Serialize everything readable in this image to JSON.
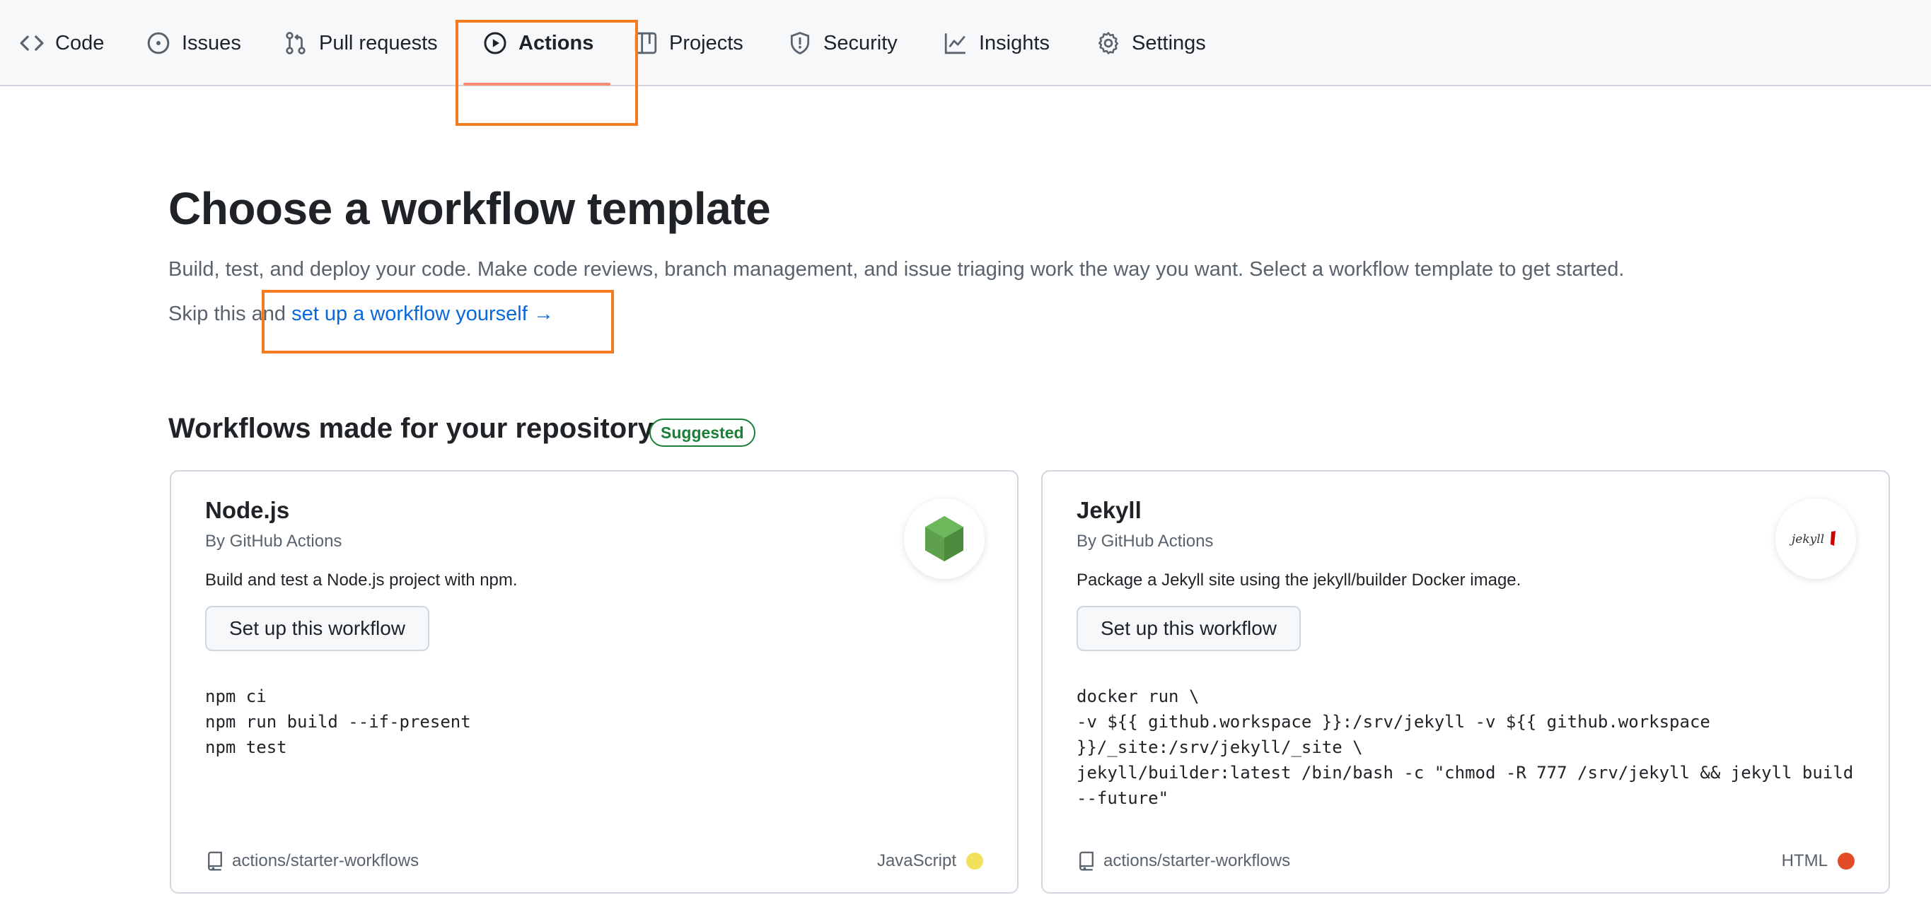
{
  "nav": {
    "tabs": [
      {
        "label": "Code",
        "icon": "code-icon"
      },
      {
        "label": "Issues",
        "icon": "issue-opened-icon"
      },
      {
        "label": "Pull requests",
        "icon": "git-pull-request-icon"
      },
      {
        "label": "Actions",
        "icon": "play-icon",
        "active": true
      },
      {
        "label": "Projects",
        "icon": "table-icon"
      },
      {
        "label": "Security",
        "icon": "shield-icon"
      },
      {
        "label": "Insights",
        "icon": "graph-icon"
      },
      {
        "label": "Settings",
        "icon": "gear-icon"
      }
    ]
  },
  "hero": {
    "title": "Choose a workflow template",
    "description": "Build, test, and deploy your code. Make code reviews, branch management, and issue triaging work the way you want. Select a workflow template to get started.",
    "skip_prefix": "Skip this and ",
    "skip_link": "set up a workflow yourself",
    "skip_arrow": "→"
  },
  "section": {
    "title": "Workflows made for your repository",
    "badge": "Suggested"
  },
  "cards": [
    {
      "title": "Node.js",
      "author": "By GitHub Actions",
      "description": "Build and test a Node.js project with npm.",
      "button": "Set up this workflow",
      "code": "npm ci\nnpm run build --if-present\nnpm test",
      "repo": "actions/starter-workflows",
      "language": "JavaScript",
      "language_color": "#f1e05a",
      "logo": "nodejs-logo"
    },
    {
      "title": "Jekyll",
      "author": "By GitHub Actions",
      "description": "Package a Jekyll site using the jekyll/builder Docker image.",
      "button": "Set up this workflow",
      "code": "docker run \\\n-v ${{ github.workspace }}:/srv/jekyll -v ${{ github.workspace\n}}/_site:/srv/jekyll/_site \\\njekyll/builder:latest /bin/bash -c \"chmod -R 777 /srv/jekyll && jekyll build\n--future\"",
      "repo": "actions/starter-workflows",
      "language": "HTML",
      "language_color": "#e34c26",
      "logo": "jekyll-logo",
      "logo_text": "jekyll"
    }
  ],
  "colors": {
    "accent_underline": "#fd8c73",
    "highlight_box": "#f47b20",
    "link": "#0969da",
    "badge_green": "#1a7f37"
  }
}
